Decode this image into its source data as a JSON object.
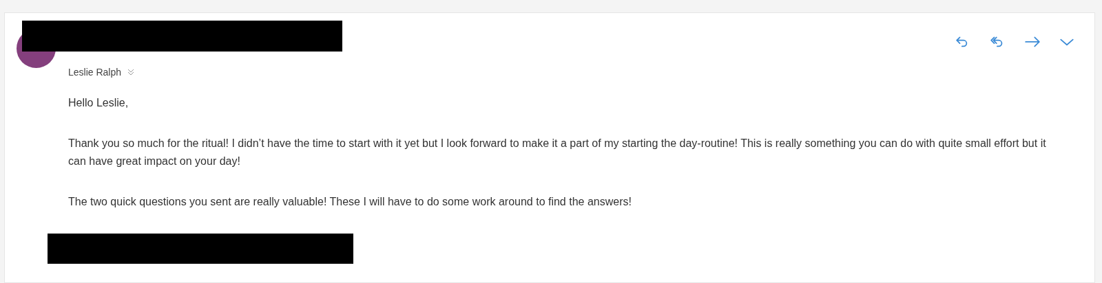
{
  "message": {
    "recipient": "Leslie Ralph",
    "actions": [
      {
        "kind": "reply"
      },
      {
        "kind": "reply-all"
      },
      {
        "kind": "forward"
      },
      {
        "kind": "more"
      }
    ],
    "body": [
      "Hello Leslie,",
      "Thank you so much for the ritual! I didn’t have the time to start with it yet but I look forward to make it a part of my starting the day-routine! This is really something you can do with quite small effort but it can have great impact on your day!",
      "The two quick questions you sent are really valuable! These I will have to do some work around to find the answers!"
    ]
  }
}
